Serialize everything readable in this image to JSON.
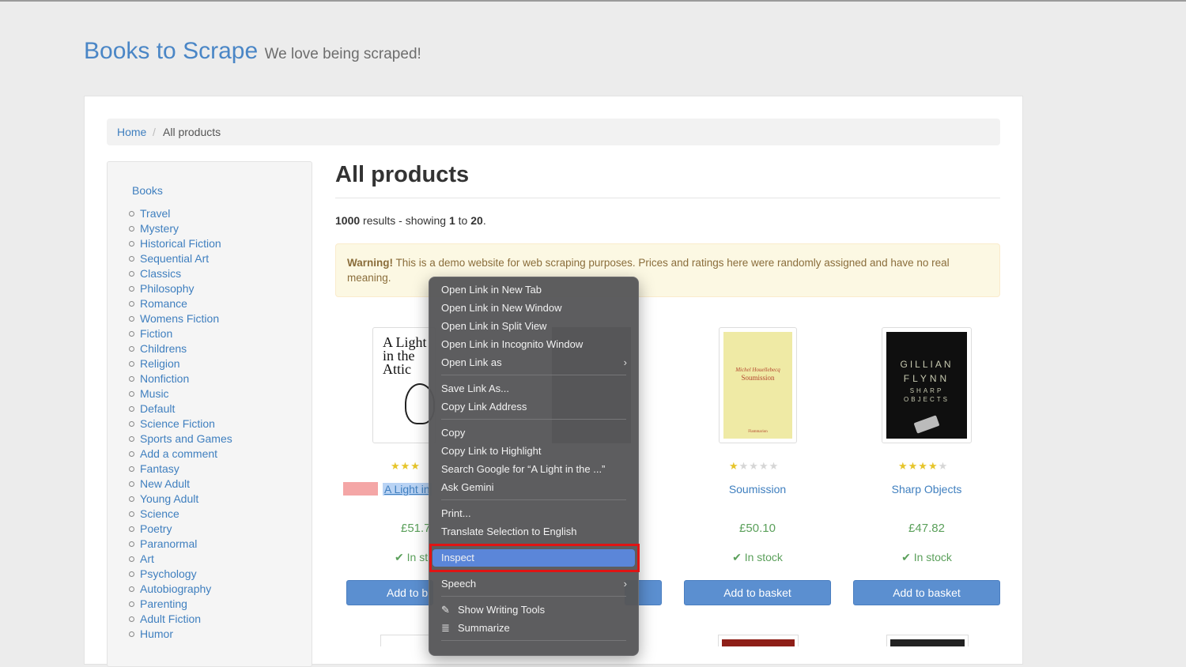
{
  "brand": {
    "title": "Books to Scrape",
    "tagline": "We love being scraped!"
  },
  "breadcrumb": {
    "home": "Home",
    "separator": "/",
    "current": "All products"
  },
  "sidebar": {
    "root": "Books",
    "categories": [
      "Travel",
      "Mystery",
      "Historical Fiction",
      "Sequential Art",
      "Classics",
      "Philosophy",
      "Romance",
      "Womens Fiction",
      "Fiction",
      "Childrens",
      "Religion",
      "Nonfiction",
      "Music",
      "Default",
      "Science Fiction",
      "Sports and Games",
      "Add a comment",
      "Fantasy",
      "New Adult",
      "Young Adult",
      "Science",
      "Poetry",
      "Paranormal",
      "Art",
      "Psychology",
      "Autobiography",
      "Parenting",
      "Adult Fiction",
      "Humor"
    ]
  },
  "main": {
    "title": "All products",
    "results": {
      "total": "1000",
      "text1": " results - showing ",
      "from": "1",
      "text2": " to ",
      "to": "20",
      "text3": "."
    },
    "warning": {
      "label": "Warning!",
      "text": " This is a demo website for web scraping purposes. Prices and ratings here were randomly assigned and have no real meaning."
    }
  },
  "products": [
    {
      "title": "A Light in",
      "price": "£51.7",
      "stock": "In st",
      "basket": "Add to b",
      "rating": 3,
      "cover_text": [
        "A Light",
        "in the",
        "Attic"
      ]
    },
    {
      "title": "Soumission",
      "price": "£50.10",
      "stock": "In stock",
      "basket": "Add to basket",
      "rating": 1,
      "cover_text": [
        "Michel Houellebecq",
        "Soumission",
        "Flammarion"
      ]
    },
    {
      "title": "Sharp Objects",
      "price": "£47.82",
      "stock": "In stock",
      "basket": "Add to basket",
      "rating": 4,
      "cover_text": [
        "GILLIAN",
        "FLYNN",
        "SHARP",
        "OBJECTS"
      ]
    }
  ],
  "context_menu": {
    "items": [
      {
        "label": "Open Link in New Tab"
      },
      {
        "label": "Open Link in New Window"
      },
      {
        "label": "Open Link in Split View"
      },
      {
        "label": "Open Link in Incognito Window"
      },
      {
        "label": "Open Link as",
        "submenu": true
      },
      {
        "label": "Save Link As..."
      },
      {
        "label": "Copy Link Address"
      },
      {
        "label": "Copy"
      },
      {
        "label": "Copy Link to Highlight"
      },
      {
        "label": "Search Google for “A Light in the ...”"
      },
      {
        "label": "Ask Gemini"
      },
      {
        "label": "Print..."
      },
      {
        "label": "Translate Selection to English"
      },
      {
        "label": "Inspect",
        "highlighted": true
      },
      {
        "label": "Speech",
        "submenu": true
      },
      {
        "label": "Show Writing Tools",
        "icon": "writing-tools-icon"
      },
      {
        "label": "Summarize",
        "icon": "summarize-icon"
      }
    ]
  },
  "colors": {
    "link": "#3f7fbf",
    "price": "#5ba05b",
    "highlight": "#5b86d9",
    "annotation": "#e01414"
  }
}
